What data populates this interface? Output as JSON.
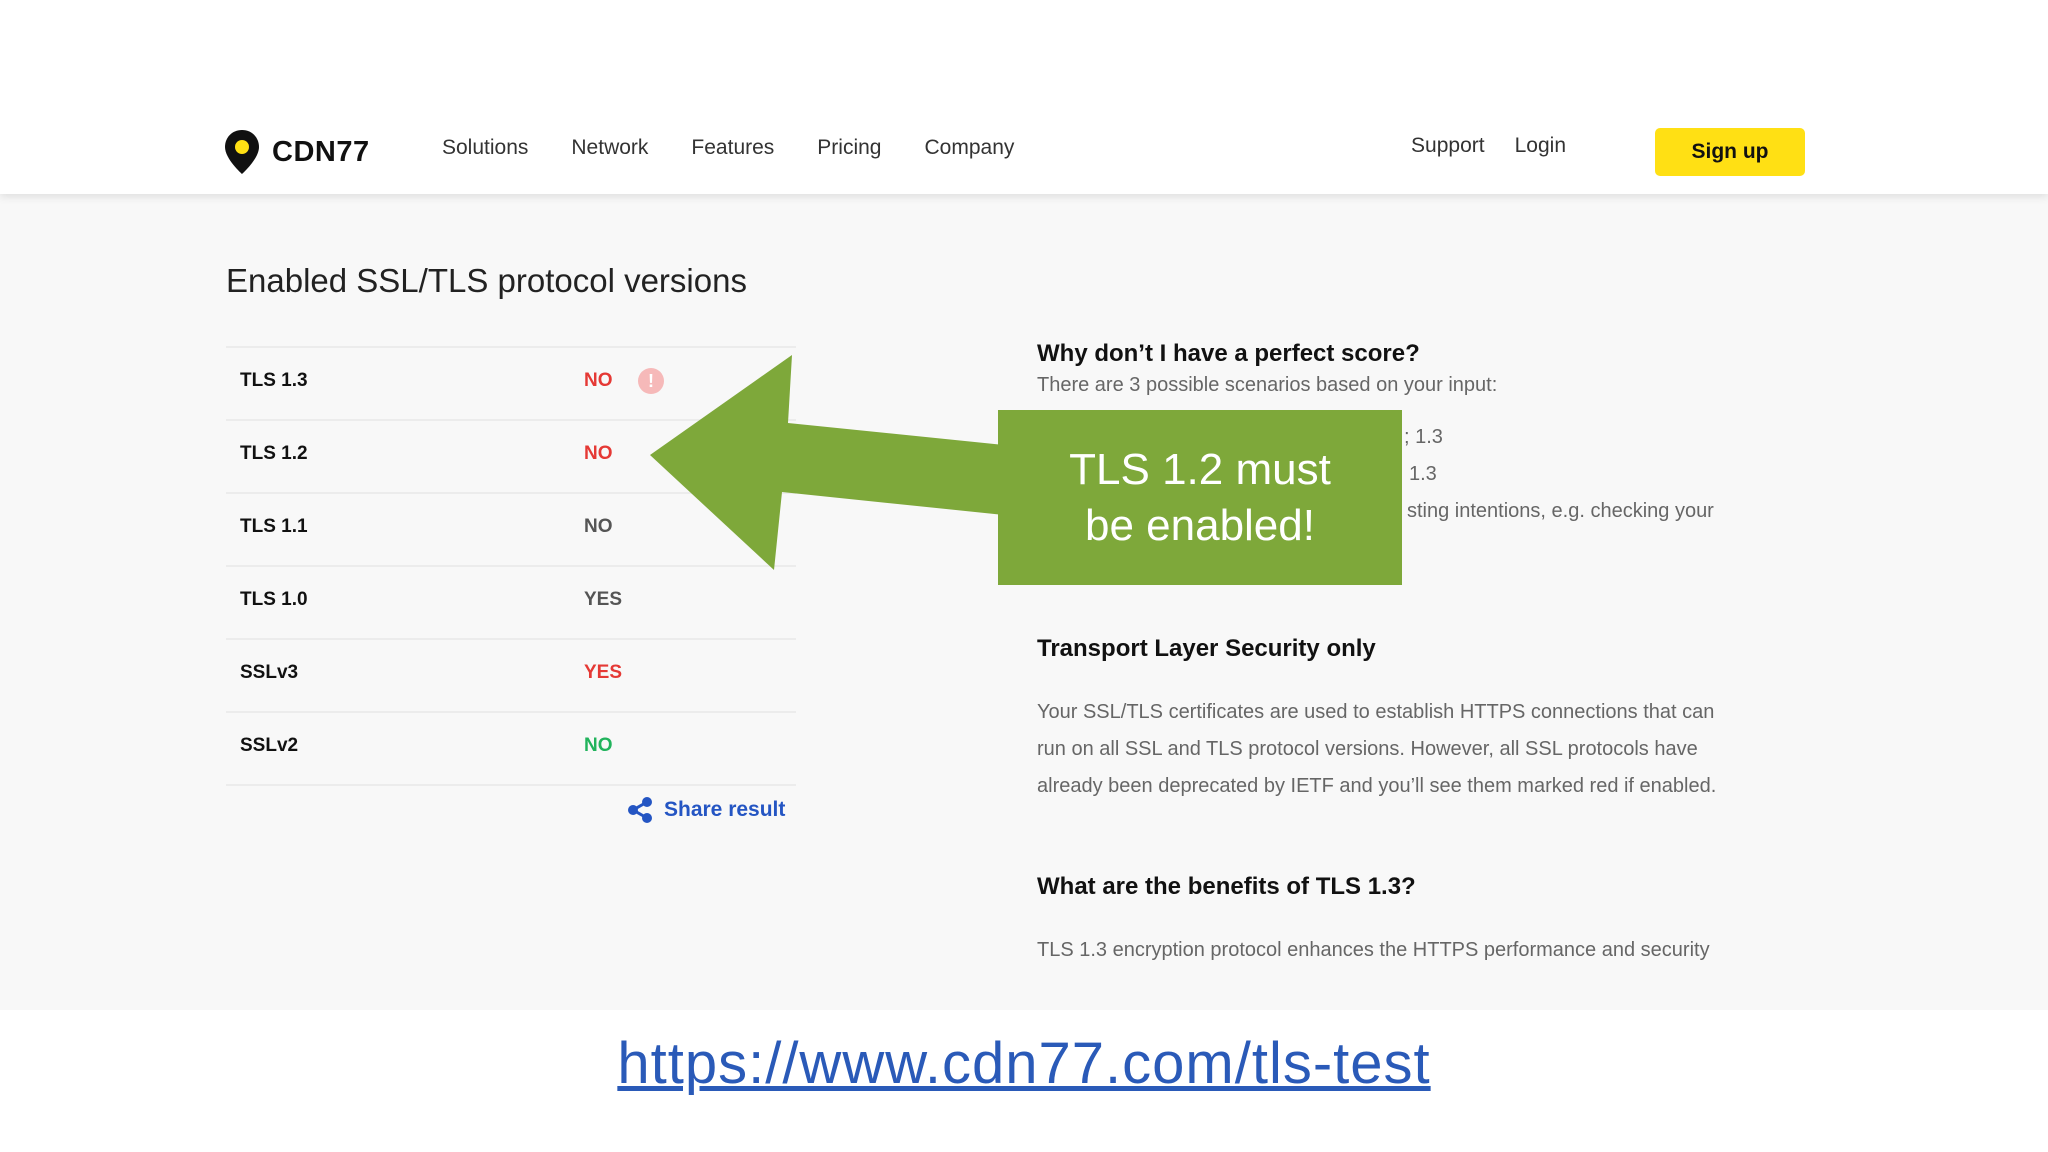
{
  "brand": {
    "name": "CDN77"
  },
  "nav": {
    "items": [
      "Solutions",
      "Network",
      "Features",
      "Pricing",
      "Company"
    ],
    "support": "Support",
    "login": "Login",
    "signup": "Sign up"
  },
  "section_title": "Enabled SSL/TLS protocol versions",
  "protocols": [
    {
      "name": "TLS 1.3",
      "value": "NO",
      "color": "#e53935",
      "warning": "!"
    },
    {
      "name": "TLS 1.2",
      "value": "NO",
      "color": "#e53935"
    },
    {
      "name": "TLS 1.1",
      "value": "NO",
      "color": "#555555"
    },
    {
      "name": "TLS 1.0",
      "value": "YES",
      "color": "#555555"
    },
    {
      "name": "SSLv3",
      "value": "YES",
      "color": "#e53935"
    },
    {
      "name": "SSLv2",
      "value": "NO",
      "color": "#21b35c"
    }
  ],
  "share_label": "Share result",
  "right": {
    "q1_title": "Why don’t I have a perfect score?",
    "q1_text": "There are 3 possible scenarios based on your input:",
    "q1_frag1": "; 1.3",
    "q1_frag2": "1.3",
    "q1_frag3": "sting intentions, e.g. checking your",
    "q2_title": "Transport Layer Security only",
    "q2_lines": [
      "Your SSL/TLS certificates are used to establish HTTPS connections that can",
      "run on all SSL and TLS protocol versions. However, all SSL protocols have",
      "already been deprecated by IETF and you’ll see them marked red if enabled."
    ],
    "q3_title": "What are the benefits of TLS 1.3?",
    "q3_text": "TLS 1.3 encryption protocol enhances the HTTPS performance and security"
  },
  "callout": {
    "line1": "TLS 1.2 must",
    "line2": "be enabled!",
    "color": "#7ea83a"
  },
  "url": "https://www.cdn77.com/tls-test"
}
